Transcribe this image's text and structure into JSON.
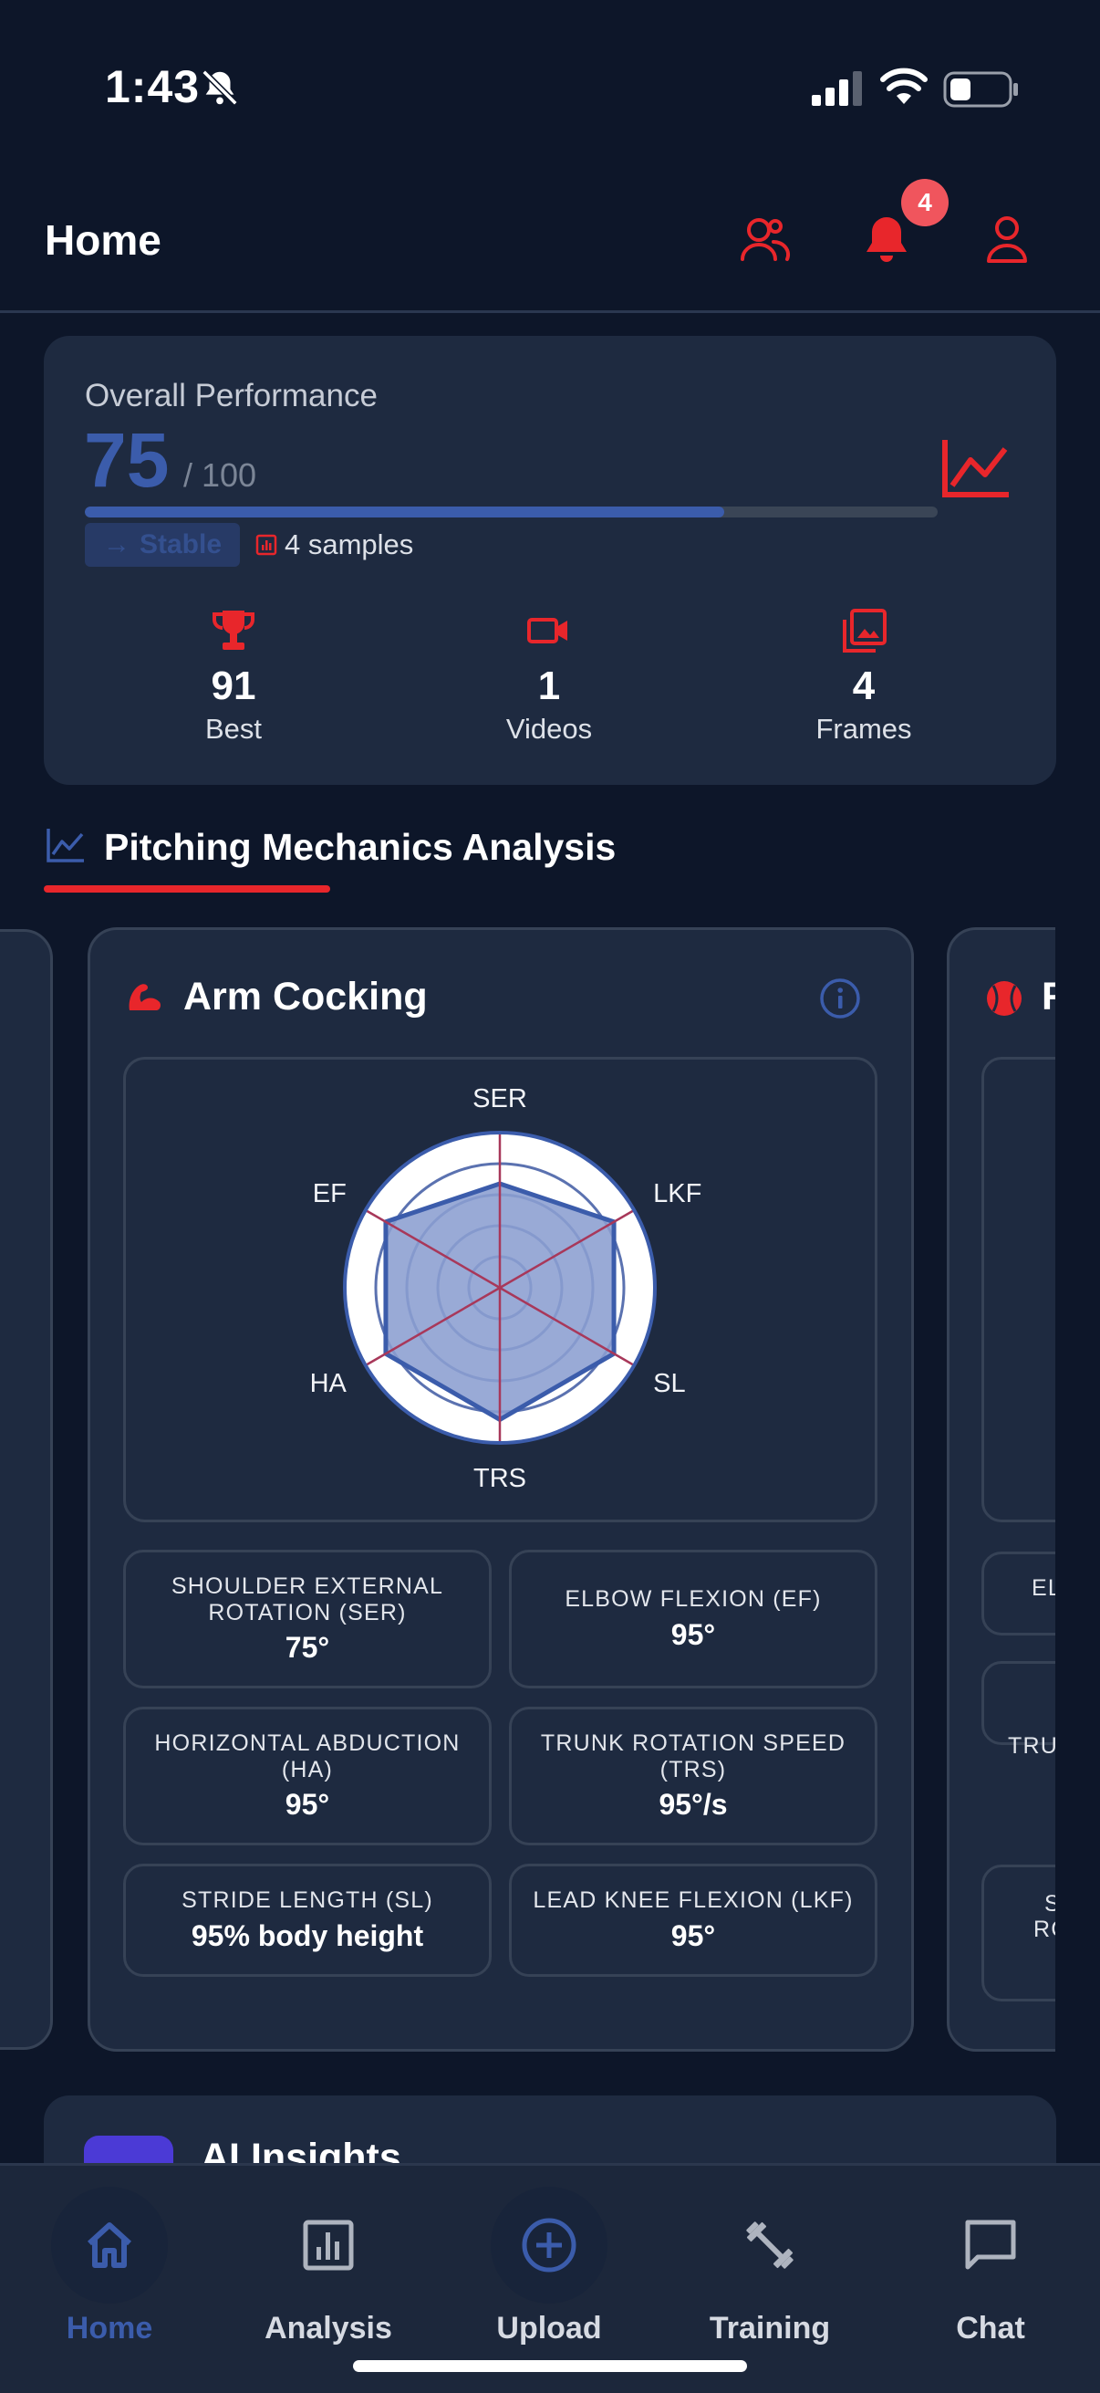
{
  "status_bar": {
    "time": "1:43"
  },
  "header": {
    "title": "Home",
    "notification_count": "4"
  },
  "performance": {
    "label": "Overall Performance",
    "score": "75",
    "max": "/ 100",
    "progress": 0.75,
    "trend_label": "Stable",
    "samples": "4 samples",
    "stats": [
      {
        "value": "91",
        "label": "Best"
      },
      {
        "value": "1",
        "label": "Videos"
      },
      {
        "value": "4",
        "label": "Frames"
      }
    ]
  },
  "section": {
    "title": "Pitching Mechanics Analysis"
  },
  "card": {
    "title": "Arm Cocking",
    "radar": {
      "axes": [
        "SER",
        "LKF",
        "SL",
        "TRS",
        "HA",
        "EF"
      ],
      "values": [
        75,
        95,
        95,
        95,
        95,
        95
      ],
      "max": 100
    },
    "metrics": [
      {
        "label": "SHOULDER EXTERNAL ROTATION (SER)",
        "value": "75°"
      },
      {
        "label": "ELBOW FLEXION (EF)",
        "value": "95°"
      },
      {
        "label": "HORIZONTAL ABDUCTION (HA)",
        "value": "95°"
      },
      {
        "label": "TRUNK ROTATION SPEED (TRS)",
        "value": "95°/s"
      },
      {
        "label": "STRIDE LENGTH (SL)",
        "value": "95% body height"
      },
      {
        "label": "LEAD KNEE FLEXION (LKF)",
        "value": "95°"
      }
    ]
  },
  "peek_card": {
    "title_initial": "F",
    "texts": [
      "EL",
      "TRU",
      "S",
      "RC"
    ]
  },
  "ai_insights": {
    "title": "AI Insights"
  },
  "nav": [
    {
      "label": "Home",
      "icon": "home-icon"
    },
    {
      "label": "Analysis",
      "icon": "bar-chart-icon"
    },
    {
      "label": "Upload",
      "icon": "plus-circle-icon"
    },
    {
      "label": "Training",
      "icon": "dumbbell-icon"
    },
    {
      "label": "Chat",
      "icon": "chat-icon"
    }
  ],
  "colors": {
    "accent_red": "#e8262b",
    "accent_blue": "#3b5cab",
    "background": "#0d1629",
    "card": "#1e2a40"
  }
}
